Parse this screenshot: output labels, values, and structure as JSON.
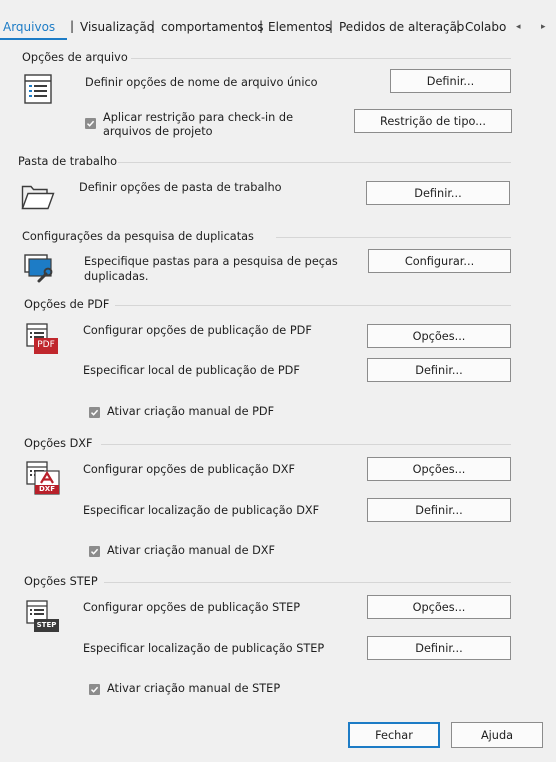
{
  "tabs": [
    {
      "label": "Arquivos"
    },
    {
      "label": "Visualização"
    },
    {
      "label": "comportamentos"
    },
    {
      "label": "Elementos"
    },
    {
      "label": "Pedidos de alteração"
    },
    {
      "label": "Colabor"
    }
  ],
  "tab_separator": "|",
  "arrows": {
    "left": "◂",
    "right": "▸"
  },
  "file_options": {
    "title": "Opções de arquivo",
    "unique_name_label": "Definir opções de nome de arquivo único",
    "unique_name_button": "Definir...",
    "checkin_checked": true,
    "checkin_label_line1": "Aplicar restrição para check-in de",
    "checkin_label_line2": "arquivos de projeto",
    "type_restriction_button": "Restrição de tipo..."
  },
  "workspace": {
    "title": "Pasta de trabalho",
    "label": "Definir opções de pasta de trabalho",
    "button": "Definir..."
  },
  "duplicate_search": {
    "title": "Configurações da pesquisa de duplicatas",
    "label_line1": "Especifique pastas para a pesquisa de peças",
    "label_line2": "duplicadas.",
    "button": "Configurar..."
  },
  "pdf": {
    "title": "Opções de PDF",
    "icon_text": "PDF",
    "configure_label": "Configurar opções de publicação de PDF",
    "options_button": "Opções...",
    "location_label": "Especificar local de publicação de PDF",
    "location_button": "Definir...",
    "manual_checked": true,
    "manual_label": "Ativar criação manual de PDF"
  },
  "dxf": {
    "title": "Opções DXF",
    "icon_text": "DXF",
    "configure_label": "Configurar opções de publicação DXF",
    "options_button": "Opções...",
    "location_label": "Especificar localização de publicação DXF",
    "location_button": "Definir...",
    "manual_checked": true,
    "manual_label": "Ativar criação manual de DXF"
  },
  "step": {
    "title": "Opções STEP",
    "icon_text": "STEP",
    "configure_label": "Configurar opções de publicação STEP",
    "options_button": "Opções...",
    "location_label": "Especificar localização de publicação STEP",
    "location_button": "Definir...",
    "manual_checked": true,
    "manual_label": "Ativar criação manual de STEP"
  },
  "footer": {
    "close_button": "Fechar",
    "help_button": "Ajuda"
  },
  "colors": {
    "accent": "#1d7cc6",
    "pdf_red": "#c0272d",
    "dxf_red": "#b8202a",
    "step_dark": "#3a3a3a"
  }
}
